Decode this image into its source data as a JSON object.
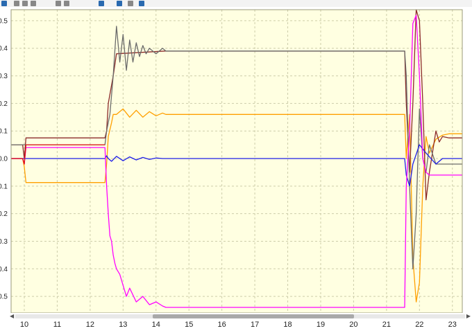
{
  "toolbar": {
    "icons": [
      "save-icon",
      "select-icon",
      "zoom-icon",
      "pan-icon",
      "fit-icon",
      "cursor-icon",
      "undo-icon",
      "split-icon",
      "marker-icon",
      "settings-icon"
    ]
  },
  "colors": {
    "plot_background": "#ffffe1",
    "grid": "#cdcdaa",
    "gray": "#6b6b6b",
    "brown": "#8b2a2a",
    "orange": "#ffa000",
    "blue": "#1e1ee8",
    "magenta": "#ff00ff",
    "red": "#e01010"
  },
  "chart_data": {
    "type": "line",
    "title": "",
    "xlabel": "",
    "ylabel": "",
    "xlim": [
      9.6,
      23.3
    ],
    "ylim": [
      -0.56,
      0.54
    ],
    "grid": true,
    "x_ticks": [
      "10",
      "11",
      "12",
      "13",
      "14",
      "15",
      "16",
      "17",
      "18",
      "19",
      "20",
      "21",
      "22",
      "23"
    ],
    "y_ticks": [
      {
        "value": 0.5,
        "label": "0.5"
      },
      {
        "value": 0.4,
        "label": "0.4"
      },
      {
        "value": 0.3,
        "label": "0.3"
      },
      {
        "value": 0.2,
        "label": "0.2"
      },
      {
        "value": 0.1,
        "label": "0.1"
      },
      {
        "value": 0.0,
        "label": "0.0"
      },
      {
        "value": -0.1,
        "label": "0.1"
      },
      {
        "value": -0.2,
        "label": "0.2"
      },
      {
        "value": -0.3,
        "label": "0.3"
      },
      {
        "value": -0.4,
        "label": "0.4"
      },
      {
        "value": -0.5,
        "label": "0.5"
      }
    ],
    "series": [
      {
        "color_key": "orange",
        "x": [
          9.6,
          9.95,
          10.0,
          10.05,
          12.45,
          12.5,
          12.55,
          12.65,
          12.7,
          12.8,
          13.0,
          13.2,
          13.4,
          13.6,
          13.8,
          14.0,
          14.2,
          14.3,
          21.55,
          21.6,
          21.7,
          21.8,
          21.9,
          22.0,
          22.1,
          22.2,
          22.3,
          22.5,
          22.7,
          22.9,
          23.3
        ],
        "y": [
          0.0,
          0.0,
          -0.03,
          -0.087,
          -0.087,
          -0.02,
          0.08,
          0.13,
          0.16,
          0.16,
          0.18,
          0.15,
          0.175,
          0.15,
          0.17,
          0.155,
          0.165,
          0.16,
          0.16,
          0.0,
          0.16,
          -0.36,
          -0.52,
          -0.45,
          -0.1,
          0.08,
          0.02,
          0.07,
          0.085,
          0.09,
          0.09
        ]
      },
      {
        "color_key": "brown",
        "x": [
          9.6,
          9.95,
          10.0,
          10.05,
          12.45,
          12.5,
          12.55,
          12.7,
          12.8,
          14.3,
          21.55,
          21.6,
          21.7,
          21.8,
          21.9,
          22.0,
          22.1,
          22.2,
          22.3,
          22.5,
          22.6,
          22.7,
          22.9,
          23.3
        ],
        "y": [
          0.05,
          0.05,
          0.0,
          0.075,
          0.075,
          0.1,
          0.2,
          0.3,
          0.38,
          0.39,
          0.39,
          0.2,
          -0.05,
          0.2,
          0.54,
          0.5,
          0.2,
          -0.15,
          -0.05,
          0.1,
          0.06,
          0.08,
          0.075,
          0.075
        ]
      },
      {
        "color_key": "gray",
        "x": [
          9.6,
          9.95,
          10.0,
          10.05,
          12.45,
          12.5,
          12.6,
          12.7,
          12.8,
          12.9,
          13.0,
          13.1,
          13.2,
          13.3,
          13.4,
          13.5,
          13.6,
          13.7,
          13.8,
          14.0,
          14.2,
          14.3,
          21.55,
          21.6,
          21.7,
          21.8,
          21.9,
          22.0,
          22.1,
          22.2,
          22.3,
          22.5,
          22.7,
          22.9,
          23.3
        ],
        "y": [
          0.05,
          0.05,
          0.05,
          0.05,
          0.05,
          0.1,
          0.16,
          0.3,
          0.48,
          0.35,
          0.45,
          0.32,
          0.43,
          0.35,
          0.42,
          0.37,
          0.41,
          0.38,
          0.4,
          0.38,
          0.4,
          0.39,
          0.39,
          0.3,
          -0.1,
          -0.4,
          -0.2,
          0.18,
          0.0,
          -0.05,
          0.05,
          -0.02,
          -0.02,
          -0.02,
          -0.02
        ]
      },
      {
        "color_key": "blue",
        "x": [
          9.6,
          12.45,
          12.5,
          12.55,
          12.65,
          12.8,
          13.0,
          13.2,
          13.4,
          13.6,
          13.8,
          14.0,
          14.2,
          14.3,
          21.55,
          21.6,
          21.7,
          21.8,
          22.0,
          22.2,
          22.5,
          22.7,
          23.3
        ],
        "y": [
          0.0,
          0.0,
          0.01,
          0.0,
          -0.01,
          0.008,
          -0.008,
          0.006,
          -0.005,
          0.004,
          -0.003,
          0.002,
          0.0,
          0.0,
          0.0,
          -0.06,
          -0.1,
          -0.02,
          0.05,
          0.02,
          -0.02,
          0.0,
          0.0
        ]
      },
      {
        "color_key": "magenta",
        "x": [
          9.6,
          9.95,
          10.0,
          10.05,
          12.45,
          12.5,
          12.55,
          12.6,
          12.65,
          12.7,
          12.75,
          12.8,
          12.9,
          13.0,
          13.1,
          13.2,
          13.4,
          13.6,
          13.8,
          14.0,
          14.2,
          14.3,
          21.55,
          21.6,
          21.7,
          21.8,
          21.9,
          22.0,
          22.1,
          22.2,
          22.3,
          22.5,
          22.7,
          22.9,
          23.3
        ],
        "y": [
          0.0,
          0.0,
          -0.02,
          0.04,
          0.04,
          -0.1,
          -0.2,
          -0.28,
          -0.3,
          -0.35,
          -0.38,
          -0.4,
          -0.42,
          -0.46,
          -0.5,
          -0.47,
          -0.52,
          -0.5,
          -0.53,
          -0.52,
          -0.535,
          -0.54,
          -0.54,
          -0.1,
          0.1,
          0.49,
          0.52,
          0.3,
          0.0,
          -0.05,
          -0.06,
          -0.06,
          -0.06,
          -0.06,
          -0.06
        ]
      },
      {
        "color_key": "red",
        "x": [
          9.6,
          9.95,
          10.0,
          10.05,
          12.45
        ],
        "y": [
          0.0,
          0.0,
          -0.02,
          0.05,
          0.05
        ]
      }
    ]
  }
}
